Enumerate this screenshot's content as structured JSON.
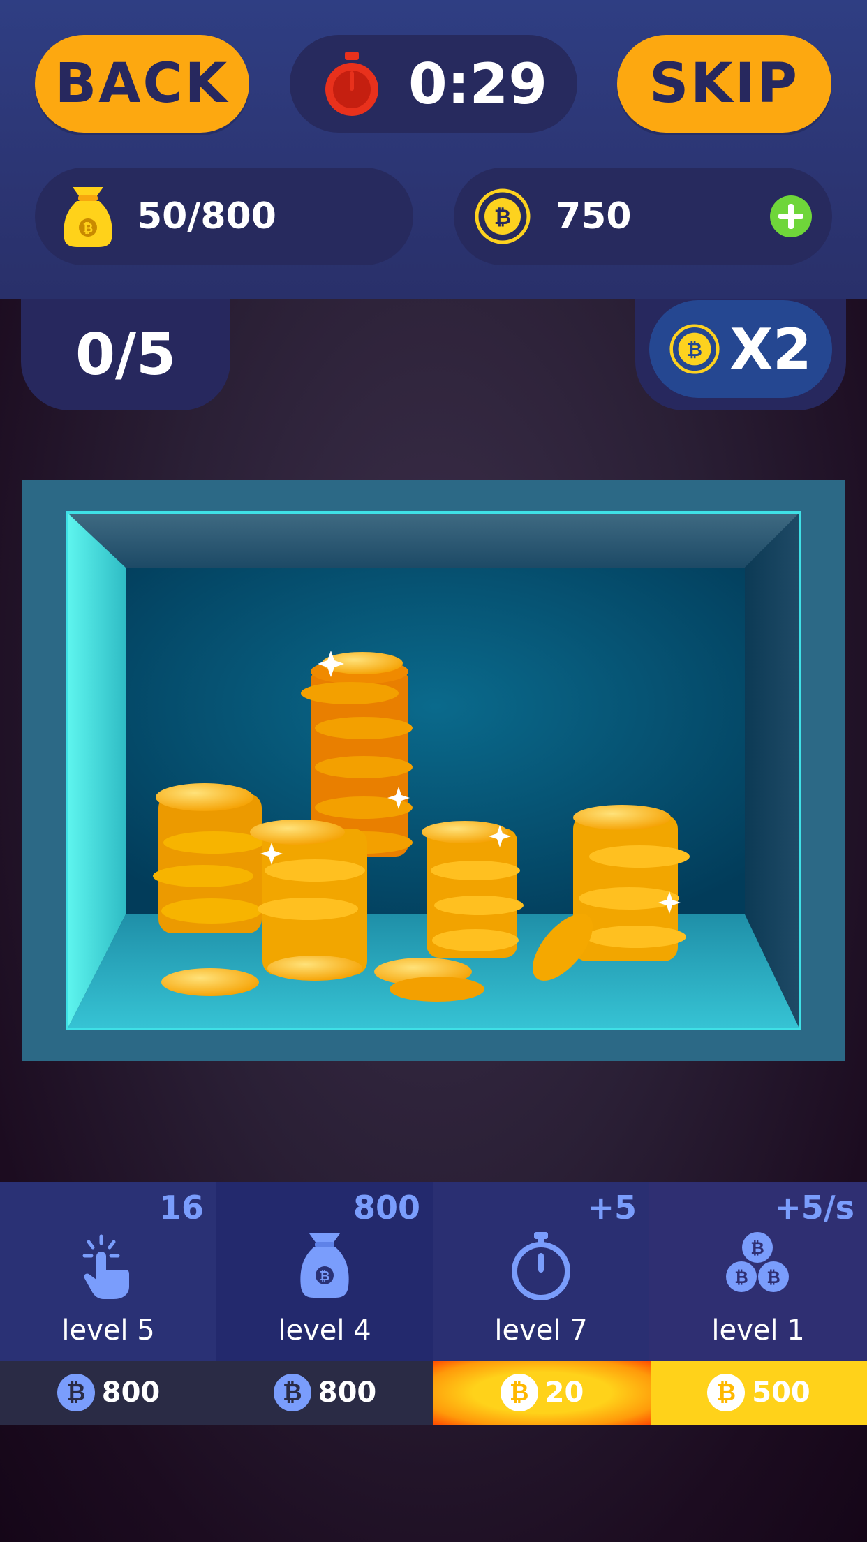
{
  "header": {
    "back_label": "BACK",
    "skip_label": "SKIP",
    "timer": "0:29"
  },
  "stats": {
    "bag": "50/800",
    "coins": "750"
  },
  "level_progress": "0/5",
  "multiplier": "X2",
  "upgrades": [
    {
      "value": "16",
      "icon": "tap-hand-icon",
      "level": "level 5",
      "price": "800"
    },
    {
      "value": "800",
      "icon": "money-bag-icon",
      "level": "level 4",
      "price": "800"
    },
    {
      "value": "+5",
      "icon": "stopwatch-icon",
      "level": "level 7",
      "price": "20"
    },
    {
      "value": "+5/s",
      "icon": "coin-stack-icon",
      "level": "level 1",
      "price": "500"
    }
  ],
  "colors": {
    "accent_orange": "#fda810",
    "panel_navy": "#272a5e",
    "upgrade_highlight": "#ffd21a",
    "upgrade_text_blue": "#7a9dfc",
    "plus_green": "#6fd63a",
    "timer_red": "#e8311c"
  }
}
